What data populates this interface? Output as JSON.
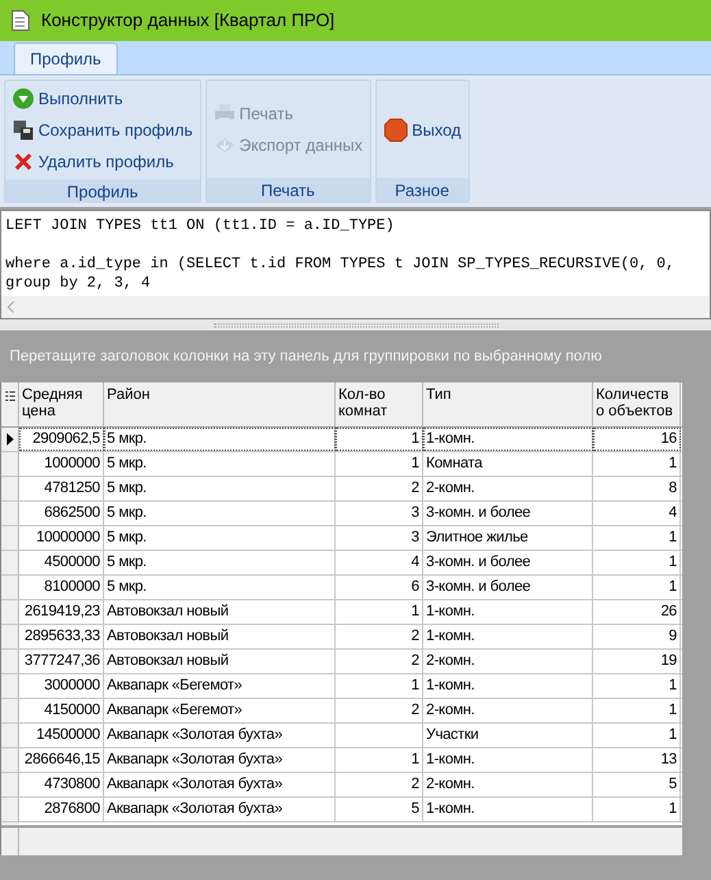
{
  "window": {
    "title": "Конструктор данных [Квартал ПРО]"
  },
  "tabs": [
    {
      "label": "Профиль",
      "selected": true
    }
  ],
  "ribbon_groups": [
    {
      "label": "Профиль",
      "buttons": [
        {
          "kind": "run",
          "label": "Выполнить",
          "disabled": false
        },
        {
          "kind": "save",
          "label": "Сохранить профиль",
          "disabled": false
        },
        {
          "kind": "delete",
          "label": "Удалить профиль",
          "disabled": false
        }
      ]
    },
    {
      "label": "Печать",
      "buttons": [
        {
          "kind": "print",
          "label": "Печать",
          "disabled": true
        },
        {
          "kind": "export",
          "label": "Экспорт данных",
          "disabled": true
        }
      ]
    },
    {
      "label": "Разное",
      "buttons": [
        {
          "kind": "exit",
          "label": "Выход",
          "disabled": false
        }
      ]
    }
  ],
  "editor": {
    "lines": [
      {
        "text": "LEFT JOIN TYPES tt1 ON (tt1.ID = a.ID_TYPE)",
        "gap_before": false
      },
      {
        "text": "where a.id_type in (SELECT t.id FROM TYPES t JOIN SP_TYPES_RECURSIVE(0, 0,",
        "gap_before": true
      },
      {
        "text": "group by 2, 3, 4",
        "gap_before": false
      }
    ]
  },
  "group_panel": {
    "hint": "Перетащите заголовок колонки на эту панель для группировки по выбранному полю"
  },
  "table": {
    "columns": [
      {
        "lines": [
          "Средняя",
          "цена"
        ],
        "kind": "number"
      },
      {
        "lines": [
          "Район"
        ],
        "kind": "text"
      },
      {
        "lines": [
          "Кол-во",
          "комнат"
        ],
        "kind": "number"
      },
      {
        "lines": [
          "Тип"
        ],
        "kind": "text"
      },
      {
        "lines": [
          "Количеств",
          "о объектов"
        ],
        "kind": "number"
      }
    ],
    "rows": [
      {
        "selected": true,
        "cells": [
          "2909062,5",
          "5 мкр.",
          "1",
          "1-комн.",
          "16"
        ]
      },
      {
        "selected": false,
        "cells": [
          "1000000",
          "5 мкр.",
          "1",
          "Комната",
          "1"
        ]
      },
      {
        "selected": false,
        "cells": [
          "4781250",
          "5 мкр.",
          "2",
          "2-комн.",
          "8"
        ]
      },
      {
        "selected": false,
        "cells": [
          "6862500",
          "5 мкр.",
          "3",
          "3-комн. и более",
          "4"
        ]
      },
      {
        "selected": false,
        "cells": [
          "10000000",
          "5 мкр.",
          "3",
          "Элитное жилье",
          "1"
        ]
      },
      {
        "selected": false,
        "cells": [
          "4500000",
          "5 мкр.",
          "4",
          "3-комн. и более",
          "1"
        ]
      },
      {
        "selected": false,
        "cells": [
          "8100000",
          "5 мкр.",
          "6",
          "3-комн. и более",
          "1"
        ]
      },
      {
        "selected": false,
        "cells": [
          "2619419,23",
          "Автовокзал новый",
          "1",
          "1-комн.",
          "26"
        ]
      },
      {
        "selected": false,
        "cells": [
          "2895633,33",
          "Автовокзал новый",
          "2",
          "1-комн.",
          "9"
        ]
      },
      {
        "selected": false,
        "cells": [
          "3777247,36",
          "Автовокзал новый",
          "2",
          "2-комн.",
          "19"
        ]
      },
      {
        "selected": false,
        "cells": [
          "3000000",
          "Аквапарк «Бегемот»",
          "1",
          "1-комн.",
          "1"
        ]
      },
      {
        "selected": false,
        "cells": [
          "4150000",
          "Аквапарк «Бегемот»",
          "2",
          "2-комн.",
          "1"
        ]
      },
      {
        "selected": false,
        "cells": [
          "14500000",
          "Аквапарк «Золотая бухта»",
          "",
          "Участки",
          "1"
        ]
      },
      {
        "selected": false,
        "cells": [
          "2866646,15",
          "Аквапарк «Золотая бухта»",
          "1",
          "1-комн.",
          "13"
        ]
      },
      {
        "selected": false,
        "cells": [
          "4730800",
          "Аквапарк «Золотая бухта»",
          "2",
          "2-комн.",
          "5"
        ]
      },
      {
        "selected": false,
        "cells": [
          "2876800",
          "Аквапарк «Золотая бухта»",
          "5",
          "1-комн.",
          "1"
        ]
      }
    ]
  }
}
